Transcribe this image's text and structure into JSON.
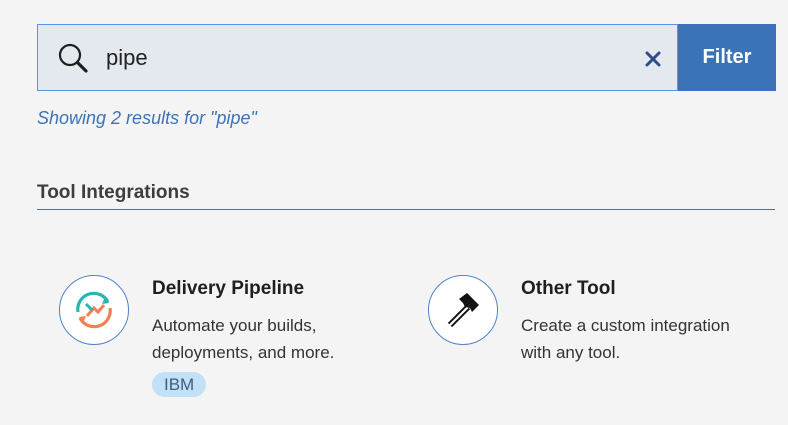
{
  "search": {
    "value": "pipe",
    "clear_icon": "close-icon",
    "search_icon": "search-icon",
    "filter_label": "Filter"
  },
  "results": {
    "summary": "Showing 2 results for \"pipe\""
  },
  "section": {
    "title": "Tool Integrations"
  },
  "cards": [
    {
      "title": "Delivery Pipeline",
      "description": "Automate your builds, deployments, and more.",
      "tag": "IBM",
      "icon": "delivery-pipeline-icon"
    },
    {
      "title": "Other Tool",
      "description": "Create a custom integration with any tool.",
      "icon": "hammer-icon"
    }
  ],
  "colors": {
    "accent": "#3b73b9",
    "search_bg": "#e4e8ef",
    "tag_bg": "#c3e1f6",
    "pipeline_teal": "#28b5b0",
    "pipeline_orange": "#f1814f"
  }
}
